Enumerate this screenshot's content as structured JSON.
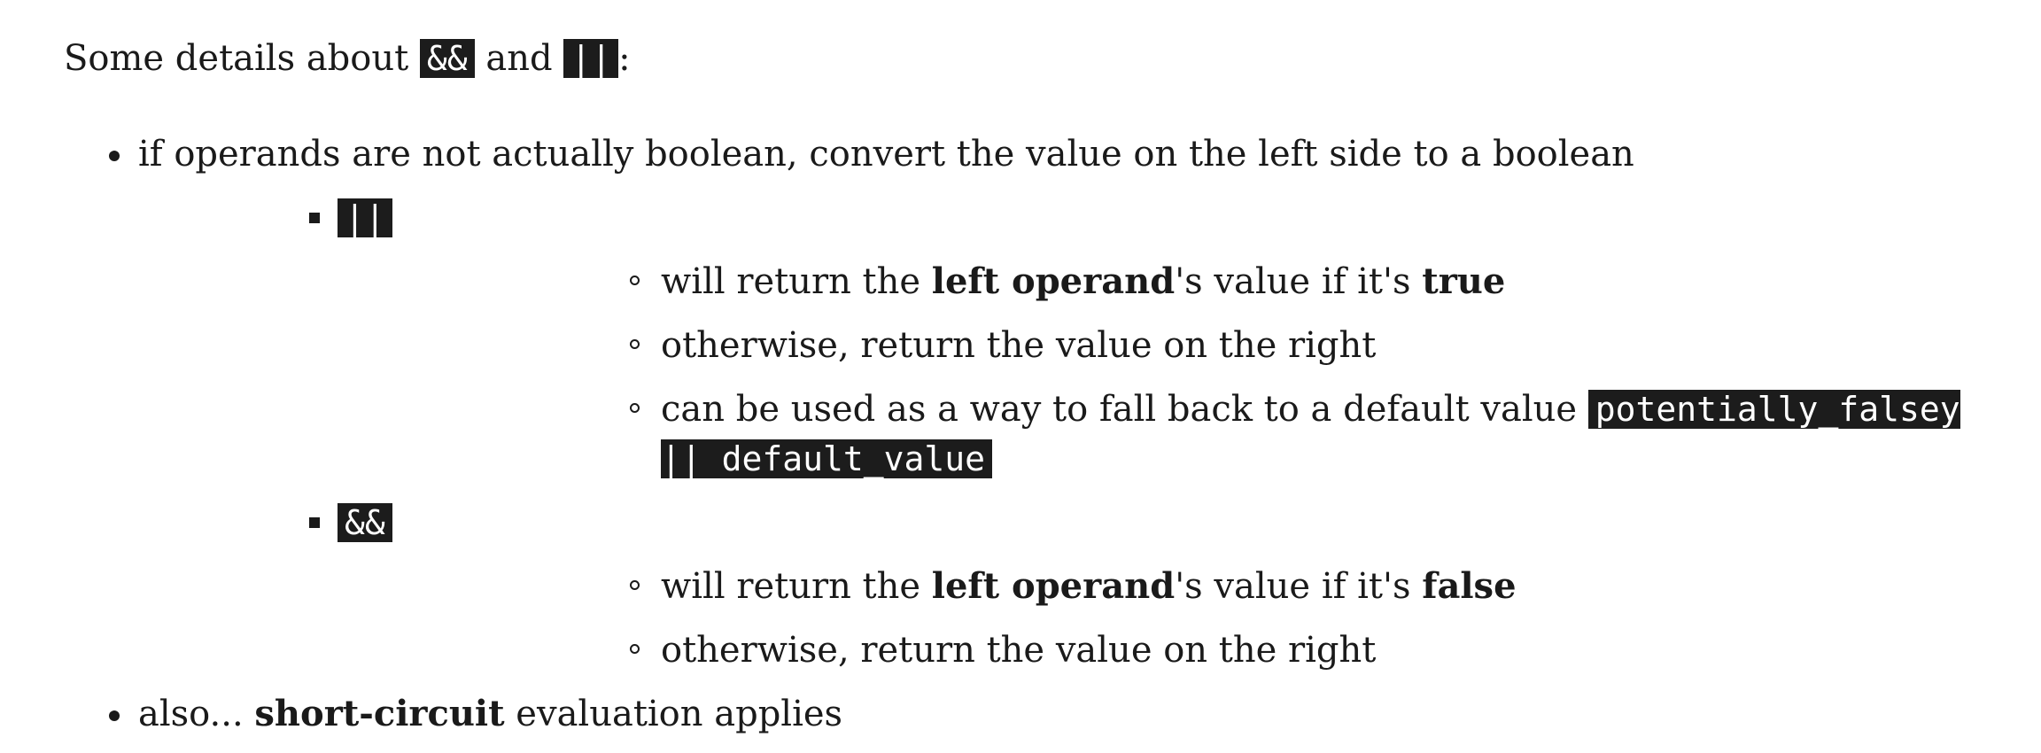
{
  "intro": {
    "prefix": "Some details about ",
    "op_and": "&&",
    "middle": " and ",
    "op_or": "||",
    "suffix": ":"
  },
  "items": [
    {
      "text": "if operands are not actually boolean, convert the value on the left side to a boolean",
      "sub": [
        {
          "code": "||",
          "points": [
            {
              "pre": "will return the ",
              "bold1": "left operand",
              "mid": "'s value if it's ",
              "bold2": "true"
            },
            {
              "text": "otherwise, return the value on the right"
            },
            {
              "text": "can be used as a way to fall back to a default value ",
              "code": "potentially_falsey || default_value"
            }
          ]
        },
        {
          "code": "&&",
          "points": [
            {
              "pre": "will return the ",
              "bold1": "left operand",
              "mid": "'s value if it's ",
              "bold2": "false"
            },
            {
              "text": "otherwise, return the value on the right"
            }
          ]
        }
      ]
    },
    {
      "pre": "also... ",
      "bold": "short-circuit",
      "post": " evaluation applies"
    }
  ]
}
